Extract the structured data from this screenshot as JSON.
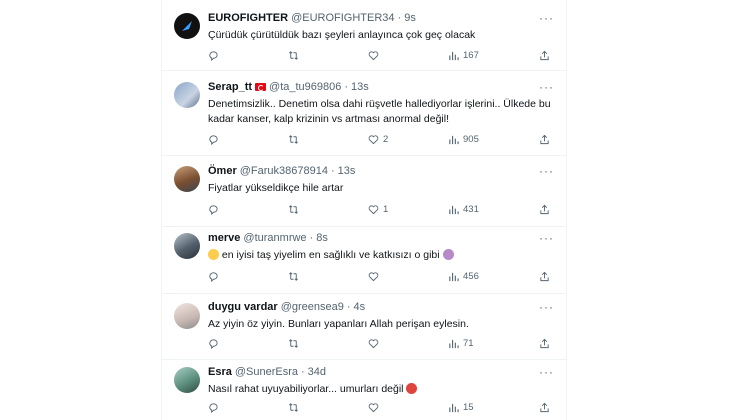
{
  "tweets": [
    {
      "name": "EUROFIGHTER",
      "handle": "@EUROFIGHTER34",
      "time": "9s",
      "text": "Çürüdük çürütüldük bazı şeyleri anlayınca çok geç olacak",
      "reply": "",
      "retweet": "",
      "like": "",
      "views": "167",
      "avatar_color": "#111111"
    },
    {
      "name": "Serap_tt",
      "handle": "@ta_tu969806",
      "time": "13s",
      "text": "Denetimsizlik.. Denetim olsa dahi rüşvetle hallediyorlar işlerini.. Ülkede bu kadar kanser, kalp krizinin vs  artması anormal değil!",
      "reply": "",
      "retweet": "",
      "like": "2",
      "views": "905",
      "avatar_color": "#8aa6c8"
    },
    {
      "name": "Ömer",
      "handle": "@Faruk38678914",
      "time": "13s",
      "text": "Fiyatlar yükseldikçe hile artar",
      "reply": "",
      "retweet": "",
      "like": "1",
      "views": "431",
      "avatar_color": "#9b7354"
    },
    {
      "name": "merve",
      "handle": "@turanmrwe",
      "time": "8s",
      "text_a": "en iyisi taş yiyelim en sağlıklı ve katkısızı o gibi",
      "reply": "",
      "retweet": "",
      "like": "",
      "views": "456",
      "avatar_color": "#6a7a88"
    },
    {
      "name": "duygu vardar",
      "handle": "@greensea9",
      "time": "4s",
      "text": "Az yiyin öz yiyin. Bunları yapanları Allah perişan eylesin.",
      "reply": "",
      "retweet": "",
      "like": "",
      "views": "71",
      "avatar_color": "#d6c9c3"
    },
    {
      "name": "Esra",
      "handle": "@SunerEsra",
      "time": "34d",
      "text_a": "Nasıl rahat uyuyabiliyorlar... umurları değil",
      "reply": "",
      "retweet": "",
      "like": "",
      "views": "15",
      "avatar_color": "#7fa89a"
    }
  ],
  "dot": "·",
  "more": "···"
}
